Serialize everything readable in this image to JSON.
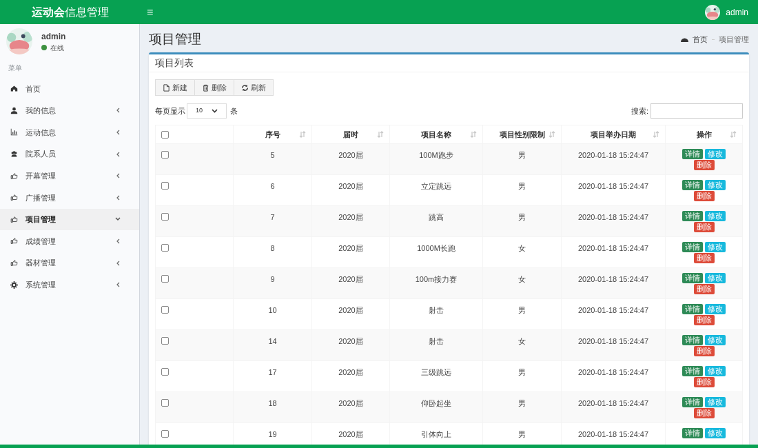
{
  "header": {
    "logo": "**运动会**信息管理",
    "menu_toggle": "≡",
    "user": "admin"
  },
  "sidebar": {
    "user": {
      "name": "admin",
      "status": "在线",
      "online": true
    },
    "section": "菜单",
    "items": [
      {
        "kind": "home",
        "label": "首页",
        "selected": false,
        "expandable": false
      },
      {
        "kind": "user",
        "label": "我的信息",
        "selected": false,
        "expandable": true
      },
      {
        "kind": "chart",
        "label": "运动信息",
        "selected": false,
        "expandable": true
      },
      {
        "kind": "users",
        "label": "院系人员",
        "selected": false,
        "expandable": true
      },
      {
        "kind": "hand",
        "label": "开幕管理",
        "selected": false,
        "expandable": true
      },
      {
        "kind": "hand",
        "label": "广播管理",
        "selected": false,
        "expandable": true
      },
      {
        "kind": "hand",
        "label": "项目管理",
        "selected": true,
        "expandable": true
      },
      {
        "kind": "hand",
        "label": "成绩管理",
        "selected": false,
        "expandable": true
      },
      {
        "kind": "hand",
        "label": "器材管理",
        "selected": false,
        "expandable": true
      },
      {
        "kind": "gear",
        "label": "系统管理",
        "selected": false,
        "expandable": true
      }
    ]
  },
  "page": {
    "title": "项目管理",
    "breadcrumb": [
      "首页",
      "项目管理"
    ]
  },
  "box": {
    "title": "项目列表",
    "toolbar": [
      {
        "kind": "file",
        "label": "新建"
      },
      {
        "kind": "trash",
        "label": "删除"
      },
      {
        "kind": "refresh",
        "label": "刷新"
      }
    ],
    "page_size": {
      "before": "每页显示",
      "value": "10",
      "after": "条"
    },
    "search": {
      "label": "搜索:"
    },
    "table": {
      "select_all_checked": false,
      "columns": [
        "序号",
        "届时",
        "项目名称",
        "项目性别限制",
        "项目举办日期",
        "操作"
      ],
      "rows": [
        {
          "checked": false,
          "cells": [
            "5",
            "2020届",
            "100M跑步",
            "男",
            "2020-01-18 15:24:47"
          ],
          "actions": [
            "详情",
            "修改",
            "删除"
          ]
        },
        {
          "checked": false,
          "cells": [
            "6",
            "2020届",
            "立定跳远",
            "男",
            "2020-01-18 15:24:47"
          ],
          "actions": [
            "详情",
            "修改",
            "删除"
          ]
        },
        {
          "checked": false,
          "cells": [
            "7",
            "2020届",
            "跳高",
            "男",
            "2020-01-18 15:24:47"
          ],
          "actions": [
            "详情",
            "修改",
            "删除"
          ]
        },
        {
          "checked": false,
          "cells": [
            "8",
            "2020届",
            "1000M长跑",
            "女",
            "2020-01-18 15:24:47"
          ],
          "actions": [
            "详情",
            "修改",
            "删除"
          ]
        },
        {
          "checked": false,
          "cells": [
            "9",
            "2020届",
            "100m接力赛",
            "女",
            "2020-01-18 15:24:47"
          ],
          "actions": [
            "详情",
            "修改",
            "删除"
          ]
        },
        {
          "checked": false,
          "cells": [
            "10",
            "2020届",
            "射击",
            "男",
            "2020-01-18 15:24:47"
          ],
          "actions": [
            "详情",
            "修改",
            "删除"
          ]
        },
        {
          "checked": false,
          "cells": [
            "14",
            "2020届",
            "射击",
            "女",
            "2020-01-18 15:24:47"
          ],
          "actions": [
            "详情",
            "修改",
            "删除"
          ]
        },
        {
          "checked": false,
          "cells": [
            "17",
            "2020届",
            "三级跳远",
            "男",
            "2020-01-18 15:24:47"
          ],
          "actions": [
            "详情",
            "修改",
            "删除"
          ]
        },
        {
          "checked": false,
          "cells": [
            "18",
            "2020届",
            "仰卧起坐",
            "男",
            "2020-01-18 15:24:47"
          ],
          "actions": [
            "详情",
            "修改",
            "删除"
          ]
        },
        {
          "checked": false,
          "cells": [
            "19",
            "2020届",
            "引体向上",
            "男",
            "2020-01-18 15:24:47"
          ],
          "actions": [
            "详情",
            "修改"
          ]
        }
      ]
    }
  }
}
